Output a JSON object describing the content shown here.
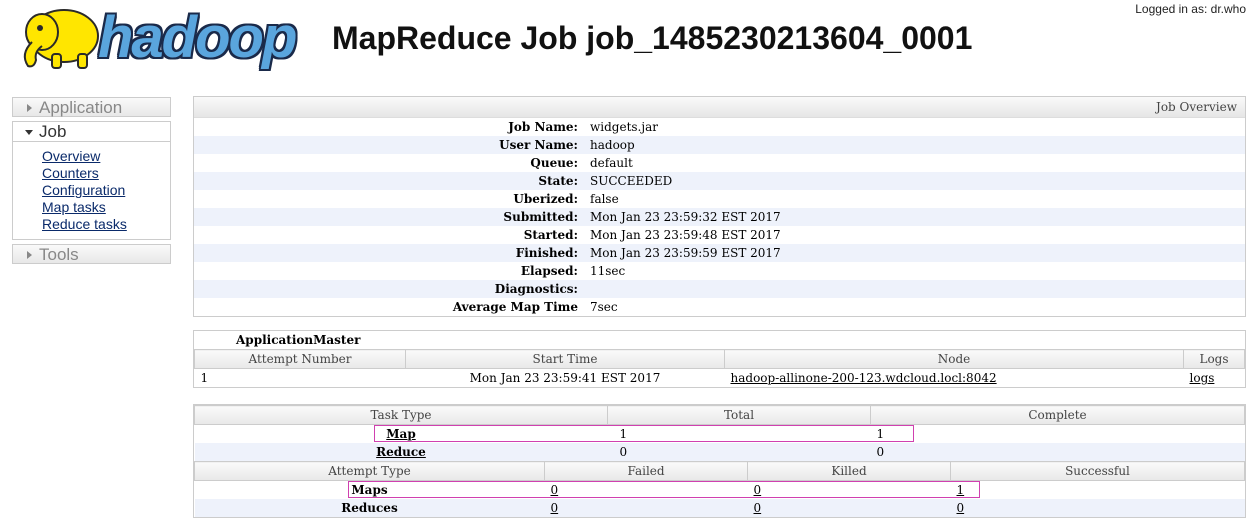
{
  "header": {
    "logged_in": "Logged in as: dr.who",
    "logo_text": "hadoop",
    "title": "MapReduce Job job_1485230213604_0001"
  },
  "nav": {
    "application": "Application",
    "job": "Job",
    "links": [
      "Overview",
      "Counters",
      "Configuration",
      "Map tasks",
      "Reduce tasks"
    ],
    "tools": "Tools"
  },
  "overview": {
    "heading": "Job Overview",
    "rows": [
      {
        "k": "Job Name:",
        "v": "widgets.jar"
      },
      {
        "k": "User Name:",
        "v": "hadoop"
      },
      {
        "k": "Queue:",
        "v": "default"
      },
      {
        "k": "State:",
        "v": "SUCCEEDED"
      },
      {
        "k": "Uberized:",
        "v": "false"
      },
      {
        "k": "Submitted:",
        "v": "Mon Jan 23 23:59:32 EST 2017"
      },
      {
        "k": "Started:",
        "v": "Mon Jan 23 23:59:48 EST 2017"
      },
      {
        "k": "Finished:",
        "v": "Mon Jan 23 23:59:59 EST 2017"
      },
      {
        "k": "Elapsed:",
        "v": "11sec"
      },
      {
        "k": "Diagnostics:",
        "v": ""
      },
      {
        "k": "Average Map Time",
        "v": "7sec"
      }
    ]
  },
  "am": {
    "title": "ApplicationMaster",
    "cols": [
      "Attempt Number",
      "Start Time",
      "Node",
      "Logs"
    ],
    "row": {
      "attempt": "1",
      "start": "Mon Jan 23 23:59:41 EST 2017",
      "node": "hadoop-allinone-200-123.wdcloud.locl:8042",
      "logs": "logs"
    }
  },
  "tasks": {
    "cols": [
      "Task Type",
      "Total",
      "Complete"
    ],
    "rows": [
      {
        "type": "Map",
        "total": "1",
        "complete": "1"
      },
      {
        "type": "Reduce",
        "total": "0",
        "complete": "0"
      }
    ]
  },
  "attempts": {
    "cols": [
      "Attempt Type",
      "Failed",
      "Killed",
      "Successful"
    ],
    "rows": [
      {
        "type": "Maps",
        "failed": "0",
        "killed": "0",
        "successful": "1"
      },
      {
        "type": "Reduces",
        "failed": "0",
        "killed": "0",
        "successful": "0"
      }
    ]
  }
}
